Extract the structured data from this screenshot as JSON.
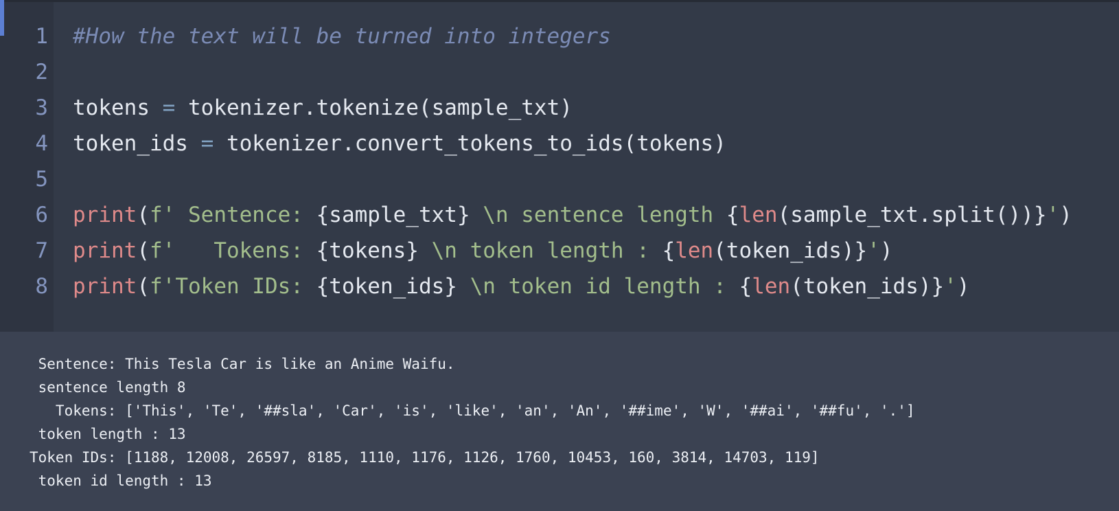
{
  "code_cell": {
    "line_numbers": [
      "1",
      "2",
      "3",
      "4",
      "5",
      "6",
      "7",
      "8"
    ],
    "lines": [
      [
        {
          "cls": "tok-comment",
          "text": "#How the text will be turned into integers"
        }
      ],
      [],
      [
        {
          "cls": "tok-plain",
          "text": "tokens "
        },
        {
          "cls": "tok-op",
          "text": "="
        },
        {
          "cls": "tok-plain",
          "text": " tokenizer.tokenize(sample_txt)"
        }
      ],
      [
        {
          "cls": "tok-plain",
          "text": "token_ids "
        },
        {
          "cls": "tok-op",
          "text": "="
        },
        {
          "cls": "tok-plain",
          "text": " tokenizer.convert_tokens_to_ids(tokens)"
        }
      ],
      [],
      [
        {
          "cls": "tok-builtin",
          "text": "print"
        },
        {
          "cls": "tok-plain",
          "text": "("
        },
        {
          "cls": "tok-string",
          "text": "f' Sentence: "
        },
        {
          "cls": "tok-brace",
          "text": "{sample_txt}"
        },
        {
          "cls": "tok-string",
          "text": " \\n sentence length "
        },
        {
          "cls": "tok-brace",
          "text": "{"
        },
        {
          "cls": "tok-builtin",
          "text": "len"
        },
        {
          "cls": "tok-plain",
          "text": "(sample_txt.split())}"
        },
        {
          "cls": "tok-string",
          "text": "'"
        },
        {
          "cls": "tok-plain",
          "text": ")"
        }
      ],
      [
        {
          "cls": "tok-builtin",
          "text": "print"
        },
        {
          "cls": "tok-plain",
          "text": "("
        },
        {
          "cls": "tok-string",
          "text": "f'   Tokens: "
        },
        {
          "cls": "tok-brace",
          "text": "{tokens}"
        },
        {
          "cls": "tok-string",
          "text": " \\n token length : "
        },
        {
          "cls": "tok-brace",
          "text": "{"
        },
        {
          "cls": "tok-builtin",
          "text": "len"
        },
        {
          "cls": "tok-plain",
          "text": "(token_ids)}"
        },
        {
          "cls": "tok-string",
          "text": "'"
        },
        {
          "cls": "tok-plain",
          "text": ")"
        }
      ],
      [
        {
          "cls": "tok-builtin",
          "text": "print"
        },
        {
          "cls": "tok-plain",
          "text": "("
        },
        {
          "cls": "tok-string",
          "text": "f'Token IDs: "
        },
        {
          "cls": "tok-brace",
          "text": "{token_ids}"
        },
        {
          "cls": "tok-string",
          "text": " \\n token id length : "
        },
        {
          "cls": "tok-brace",
          "text": "{"
        },
        {
          "cls": "tok-builtin",
          "text": "len"
        },
        {
          "cls": "tok-plain",
          "text": "(token_ids)}"
        },
        {
          "cls": "tok-string",
          "text": "'"
        },
        {
          "cls": "tok-plain",
          "text": ")"
        }
      ]
    ]
  },
  "output": {
    "lines": [
      " Sentence: This Tesla Car is like an Anime Waifu.",
      " sentence length 8",
      "   Tokens: ['This', 'Te', '##sla', 'Car', 'is', 'like', 'an', 'An', '##ime', 'W', '##ai', '##fu', '.']",
      " token length : 13",
      "Token IDs: [1188, 12008, 26597, 8185, 1110, 1176, 1126, 1760, 10453, 160, 3814, 14703, 119]",
      " token id length : 13"
    ]
  },
  "colors": {
    "background": "#3b4252",
    "code_background": "#333a48",
    "gutter_background": "#2e3441",
    "cell_indicator": "#5c7fd3",
    "comment": "#7b8bb5",
    "builtin": "#df8a8a",
    "string": "#a3be8c",
    "operator": "#81a1c1",
    "plain": "#e5e9f0",
    "line_number": "#8495bf"
  }
}
